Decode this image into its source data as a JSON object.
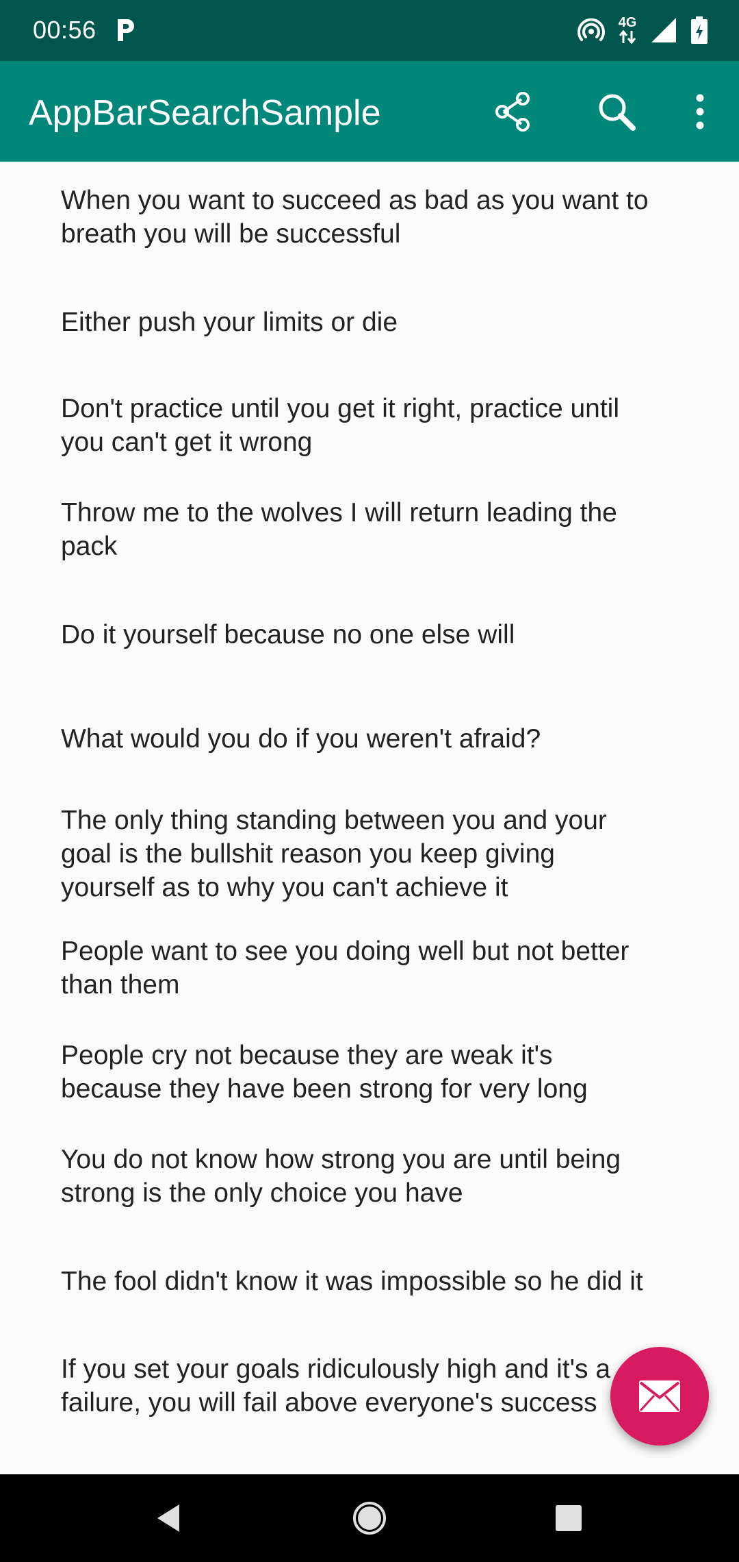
{
  "status_bar": {
    "time": "00:56",
    "app_notification_icon": "parking-p-icon",
    "network_label": "4G",
    "icons": [
      "hotspot-icon",
      "network-4g-icon",
      "signal-icon",
      "battery-icon"
    ]
  },
  "app_bar": {
    "title": "AppBarSearchSample",
    "actions": [
      "share-icon",
      "search-icon",
      "more-vert-icon"
    ],
    "color": "#00877a",
    "status_color": "#00564d"
  },
  "quotes": [
    {
      "lines": [
        "When you want to succeed as bad as you want to",
        "breath you will be successful"
      ]
    },
    {
      "lines": [
        "Either push your limits or die"
      ]
    },
    {
      "lines": [
        "Don't practice until you get it right, practice until",
        "you can't get it wrong"
      ]
    },
    {
      "lines": [
        "Throw me to the wolves I will return leading the",
        "pack"
      ]
    },
    {
      "lines": [
        "Do it yourself because no one else will"
      ]
    },
    {
      "lines": [
        "What would you do if you weren't afraid?"
      ]
    },
    {
      "lines": [
        "The only thing standing between you and your",
        "goal is the bullshit reason you keep giving",
        "yourself as to why you can't achieve it"
      ]
    },
    {
      "lines": [
        "People want to see you doing well but not better",
        "than them"
      ]
    },
    {
      "lines": [
        "People cry not because they are weak it's",
        "because they have been strong for very long"
      ]
    },
    {
      "lines": [
        "You do not know how strong you are until being",
        "strong is the only choice you have"
      ]
    },
    {
      "lines": [
        "The fool didn't know it was impossible so he did it"
      ]
    },
    {
      "lines": [
        "If you set your goals ridiculously high and it's a",
        "failure, you will fail above everyone's success"
      ]
    }
  ],
  "fab": {
    "icon": "email-icon",
    "color": "#d81b60"
  },
  "nav_bar": {
    "buttons": [
      "back-icon",
      "home-icon",
      "recents-icon"
    ]
  }
}
